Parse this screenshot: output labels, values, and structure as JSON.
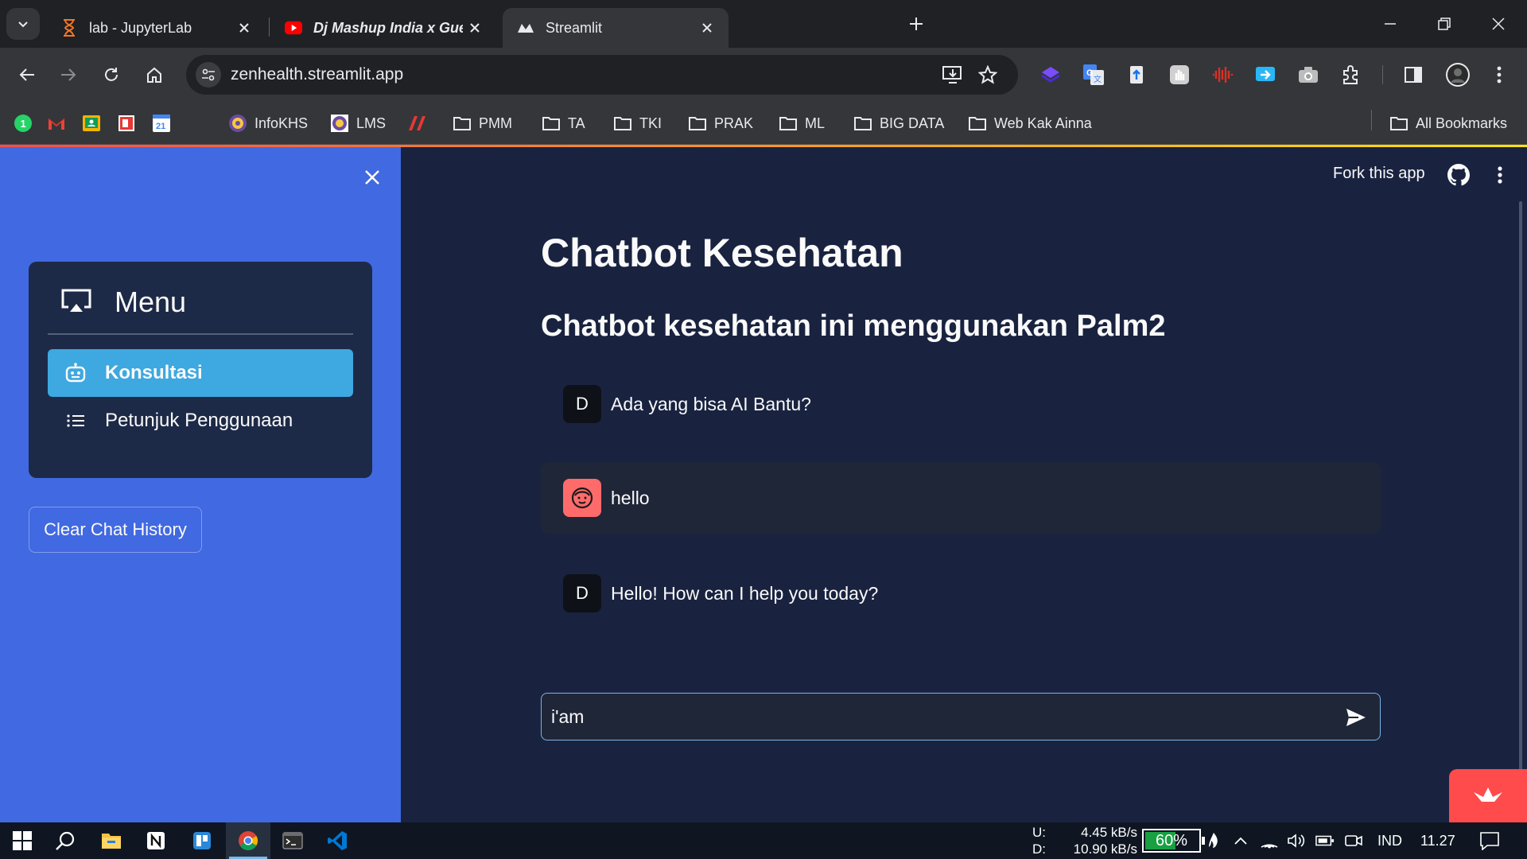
{
  "browser": {
    "tabs": [
      {
        "title": "lab - JupyterLab",
        "icon": "hourglass-icon"
      },
      {
        "title": "Dj Mashup India x Gue mah g",
        "icon": "youtube-icon"
      },
      {
        "title": "Streamlit",
        "icon": "streamlit-icon"
      }
    ],
    "active_tab_index": 2,
    "url": "zenhealth.streamlit.app",
    "bookmarks": [
      {
        "label": "",
        "icon": "whatsapp-icon"
      },
      {
        "label": "",
        "icon": "gmail-icon"
      },
      {
        "label": "",
        "icon": "google-classroom-icon"
      },
      {
        "label": "",
        "icon": "red-square-icon"
      },
      {
        "label": "",
        "icon": "calendar-icon"
      },
      {
        "label": "InfoKHS",
        "icon": "university-logo-icon"
      },
      {
        "label": "LMS",
        "icon": "university-logo-icon"
      },
      {
        "label": "",
        "icon": "red-logo-icon"
      },
      {
        "label": "PMM",
        "icon": "folder-icon"
      },
      {
        "label": "TA",
        "icon": "folder-icon"
      },
      {
        "label": "TKI",
        "icon": "folder-icon"
      },
      {
        "label": "PRAK",
        "icon": "folder-icon"
      },
      {
        "label": "ML",
        "icon": "folder-icon"
      },
      {
        "label": "BIG DATA",
        "icon": "folder-icon"
      },
      {
        "label": "Web Kak Ainna",
        "icon": "folder-icon"
      }
    ],
    "all_bookmarks_label": "All Bookmarks"
  },
  "sidebar": {
    "menu_title": "Menu",
    "menu_items": [
      {
        "label": "Konsultasi",
        "icon": "robot-icon",
        "active": true
      },
      {
        "label": "Petunjuk Penggunaan",
        "icon": "list-icon",
        "active": false
      }
    ],
    "clear_button_label": "Clear Chat History"
  },
  "header": {
    "fork_label": "Fork this app"
  },
  "main": {
    "title": "Chatbot Kesehatan",
    "subtitle": "Chatbot kesehatan ini menggunakan Palm2",
    "messages": [
      {
        "role": "assistant",
        "avatar_text": "D",
        "text": "Ada yang bisa AI Bantu?"
      },
      {
        "role": "user",
        "avatar_text": "",
        "text": "hello"
      },
      {
        "role": "assistant",
        "avatar_text": "D",
        "text": "Hello! How can I help you today?"
      }
    ],
    "chat_input_value": "i'am"
  },
  "taskbar": {
    "net_up_label": "U:",
    "net_up_value": "4.45 kB/s",
    "net_down_label": "D:",
    "net_down_value": "10.90 kB/s",
    "battery_percent": 60,
    "battery_label": "60%",
    "language": "IND",
    "time": "11.27"
  },
  "colors": {
    "sidebar_bg": "#4169e1",
    "main_bg": "#192340",
    "menu_active": "#3ea8e0",
    "streamlit_red": "#ff4b4b",
    "user_avatar": "#ff6b6b"
  }
}
